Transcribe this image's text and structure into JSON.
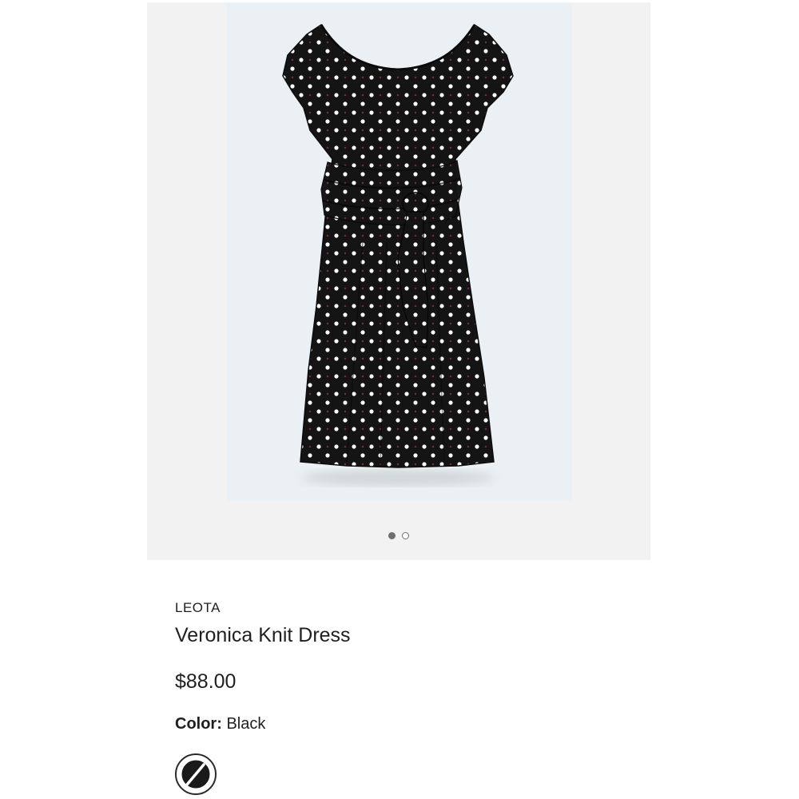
{
  "product": {
    "brand": "LEOTA",
    "name": "Veronica Knit Dress",
    "price": "$88.00",
    "color_label": "Color:",
    "color_value": "Black"
  },
  "gallery": {
    "image_count": 2,
    "active_index": 0
  },
  "colors": {
    "page_bg": "#ffffff",
    "gallery_bg": "#f2f2f2",
    "photo_bg": "#eaf0f3",
    "dress": "#141414",
    "polka_dot": "#ffffff",
    "text": "#1f1f1f"
  },
  "icons": {
    "swatch": "black-color-swatch-icon"
  }
}
